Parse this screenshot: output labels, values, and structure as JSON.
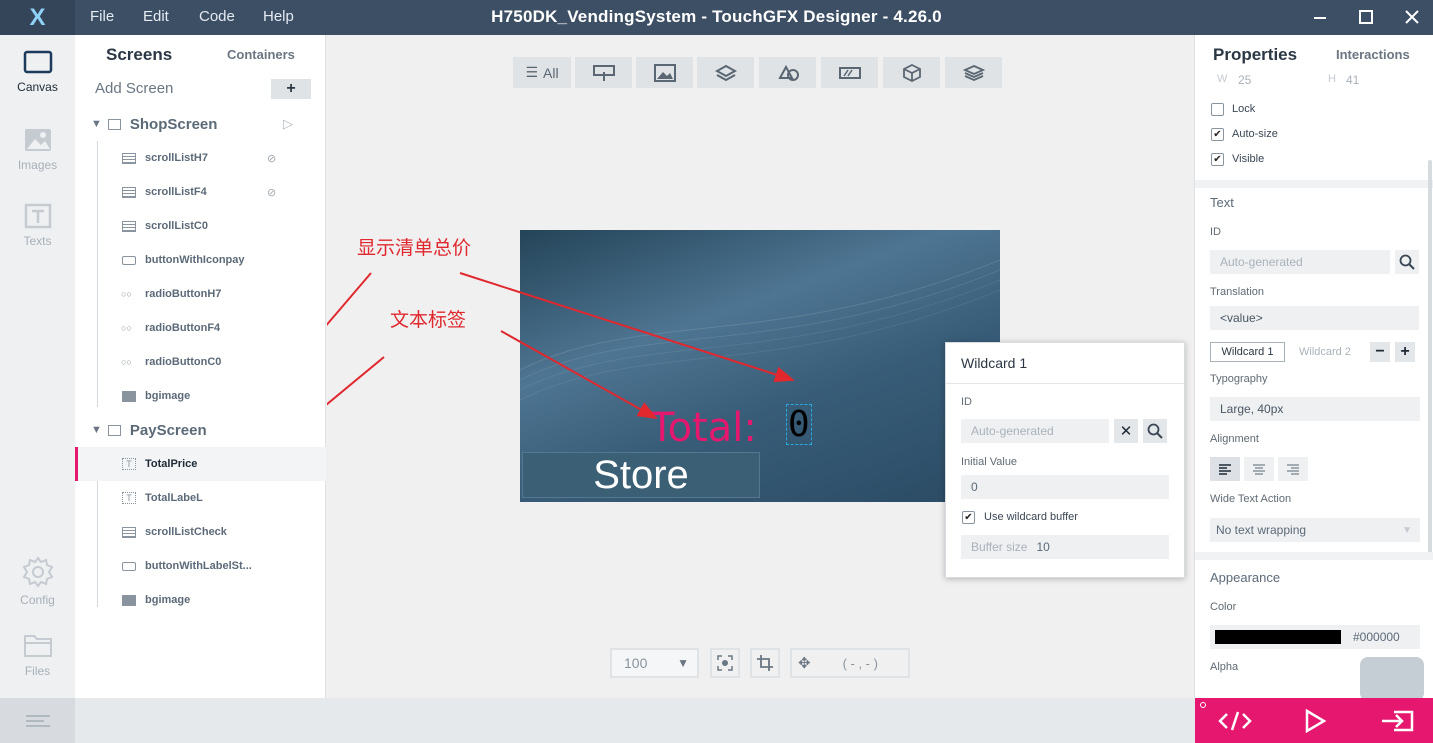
{
  "window": {
    "title": "H750DK_VendingSystem - TouchGFX Designer - 4.26.0",
    "logo": "X",
    "menu": [
      "File",
      "Edit",
      "Code",
      "Help"
    ]
  },
  "leftrail": {
    "items": [
      {
        "label": "Canvas",
        "icon": "canvas-icon"
      },
      {
        "label": "Images",
        "icon": "images-icon"
      },
      {
        "label": "Texts",
        "icon": "texts-icon"
      },
      {
        "label": "Config",
        "icon": "gear-icon"
      },
      {
        "label": "Files",
        "icon": "folder-icon"
      }
    ]
  },
  "screens": {
    "tab_screens": "Screens",
    "tab_containers": "Containers",
    "add_screen": "Add Screen",
    "add_symbol": "+",
    "screen1": {
      "name": "ShopScreen",
      "widgets": [
        "scrollListH7",
        "scrollListF4",
        "scrollListC0",
        "buttonWithIconpay",
        "radioButtonH7",
        "radioButtonF4",
        "radioButtonC0",
        "bgimage"
      ]
    },
    "screen2": {
      "name": "PayScreen",
      "widgets": [
        "TotalPrice",
        "TotalLabeL",
        "scrollListCheck",
        "buttonWithLabelSt...",
        "bgimage"
      ]
    }
  },
  "canvas": {
    "toolbar_all": "All",
    "preview_total_label": "Total:",
    "preview_total_value": "0",
    "preview_store": "Store",
    "annotations": [
      "显示清单总价",
      "文本标签"
    ],
    "zoom": "100",
    "coords": "( - , - )"
  },
  "wildcard_popup": {
    "title": "Wildcard 1",
    "id_label": "ID",
    "id_placeholder": "Auto-generated",
    "initial_value_label": "Initial Value",
    "initial_value": "0",
    "use_buffer_label": "Use wildcard buffer",
    "buffer_size_label": "Buffer size",
    "buffer_size": "10"
  },
  "properties": {
    "tab_properties": "Properties",
    "tab_interactions": "Interactions",
    "w_label": "W",
    "w_value": "25",
    "h_label": "H",
    "h_value": "41",
    "lock": "Lock",
    "auto_size": "Auto-size",
    "visible": "Visible",
    "text_section": "Text",
    "id_label": "ID",
    "id_placeholder": "Auto-generated",
    "translation_label": "Translation",
    "translation_value": "<value>",
    "wildcard1_tab": "Wildcard 1",
    "wildcard2_tab": "Wildcard 2",
    "typography_label": "Typography",
    "typography_value": "Large, 40px",
    "alignment_label": "Alignment",
    "wide_text_label": "Wide Text Action",
    "wide_text_value": "No text wrapping",
    "appearance_section": "Appearance",
    "color_label": "Color",
    "color_value": "#000000",
    "alpha_label": "Alpha"
  },
  "colors": {
    "titlebar": "#3d4f65",
    "accent": "#e5176e",
    "annotation": "#e0282e"
  }
}
